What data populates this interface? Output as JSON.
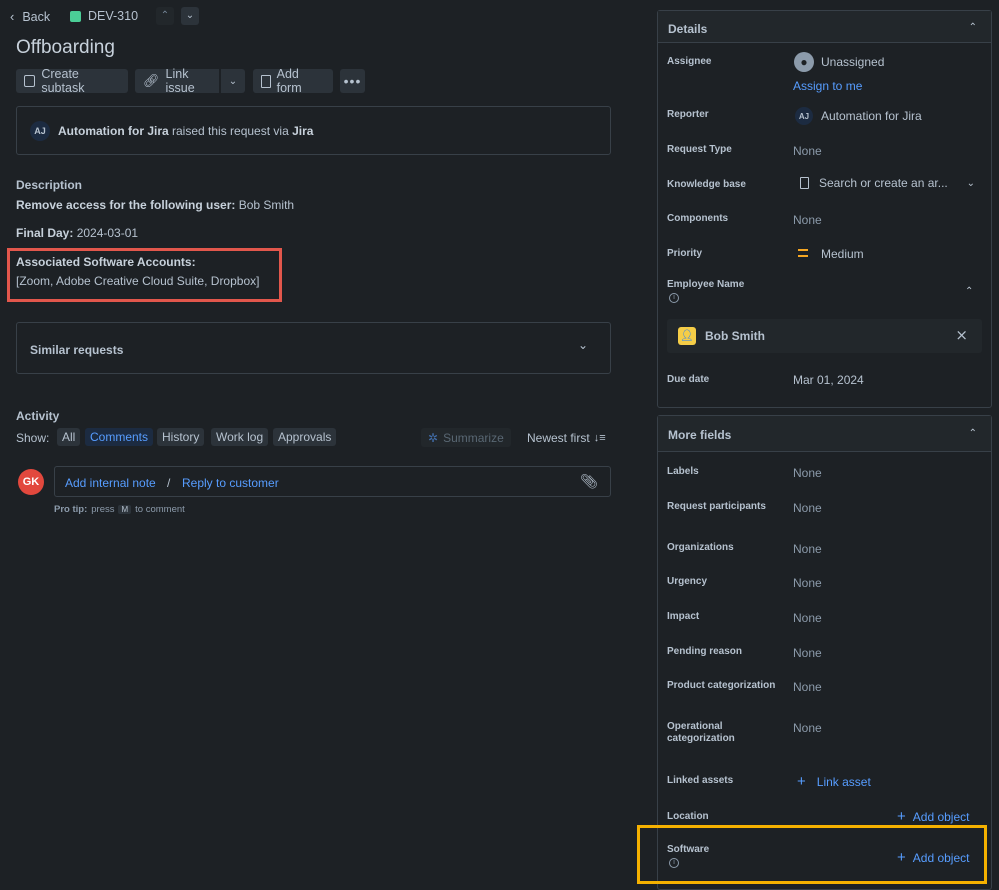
{
  "header": {
    "back_label": "Back",
    "issue_key": "DEV-310",
    "title": "Offboarding"
  },
  "toolbar": {
    "create_subtask": "Create subtask",
    "link_issue": "Link issue",
    "add_form": "Add form"
  },
  "request_info": {
    "avatar": "AJ",
    "actor": "Automation for Jira",
    "middle": "raised this request via",
    "channel": "Jira"
  },
  "description": {
    "heading": "Description",
    "line1_label": "Remove access for the following user:",
    "line1_value": " Bob Smith",
    "line2_label": "Final Day:",
    "line2_value": " 2024-03-01",
    "assoc_label": "Associated Software Accounts:",
    "assoc_value": "[Zoom, Adobe Creative Cloud Suite, Dropbox]"
  },
  "similar": {
    "label": "Similar requests"
  },
  "activity": {
    "heading": "Activity",
    "show_label": "Show:",
    "tabs": [
      "All",
      "Comments",
      "History",
      "Work log",
      "Approvals"
    ],
    "summarize": "Summarize",
    "sort": "Newest first",
    "avatar": "GK",
    "add_note": "Add internal note",
    "separator": "/",
    "reply": "Reply to customer",
    "tip_label": "Pro tip:",
    "tip_press": "press",
    "tip_key": "M",
    "tip_rest": "to comment"
  },
  "details": {
    "title": "Details",
    "assignee_label": "Assignee",
    "assignee_value": "Unassigned",
    "assign_to_me": "Assign to me",
    "reporter_label": "Reporter",
    "reporter_avatar": "AJ",
    "reporter_value": "Automation for Jira",
    "request_type_label": "Request Type",
    "request_type_value": "None",
    "kb_label": "Knowledge base",
    "kb_value": "Search or create an ar...",
    "components_label": "Components",
    "components_value": "None",
    "priority_label": "Priority",
    "priority_value": "Medium",
    "employee_label": "Employee Name",
    "employee_value": "Bob Smith",
    "due_label": "Due date",
    "due_value": "Mar 01, 2024"
  },
  "more_fields": {
    "title": "More fields",
    "labels_label": "Labels",
    "labels_value": "None",
    "participants_label": "Request participants",
    "participants_value": "None",
    "orgs_label": "Organizations",
    "orgs_value": "None",
    "urgency_label": "Urgency",
    "urgency_value": "None",
    "impact_label": "Impact",
    "impact_value": "None",
    "pending_label": "Pending reason",
    "pending_value": "None",
    "product_label": "Product categorization",
    "product_value": "None",
    "operational_label_1": "Operational",
    "operational_label_2": "categorization",
    "operational_value": "None",
    "linked_label": "Linked assets",
    "linked_value": "Link asset",
    "location_label": "Location",
    "location_value": "Add object",
    "software_label": "Software",
    "software_value": "Add object"
  },
  "colors": {
    "highlight_red": "#e2574c",
    "highlight_yellow": "#f5b100",
    "link": "#579dff",
    "priority": "#f5a623"
  }
}
